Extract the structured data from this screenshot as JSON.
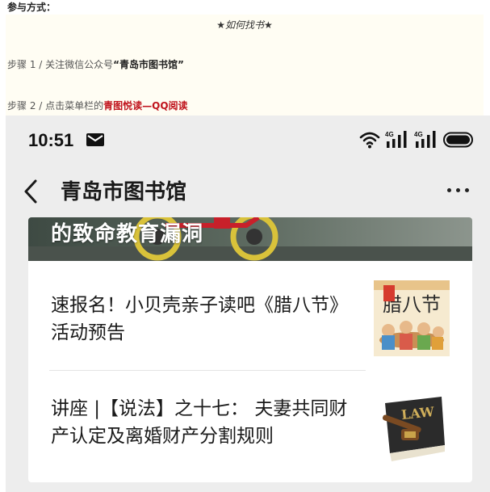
{
  "article": {
    "intro": "参与方式：",
    "how_to": "★如何找书★",
    "step1_prefix": "步骤 1 /   关注微信公众号",
    "step1_highlight": "“青岛市图书馆”",
    "step2_prefix": "步骤 2 /   点击菜单栏的",
    "step2_highlight": "青图悦读—QQ阅读"
  },
  "phone": {
    "status": {
      "time": "10:51",
      "network_label_1": "4G",
      "network_label_2": "4G"
    },
    "nav": {
      "title": "青岛市图书馆"
    },
    "banner_text": "的致命教育漏洞",
    "items": [
      {
        "title": "速报名！小贝壳亲子读吧《腊八节》活动预告",
        "thumb_text": "腊八节"
      },
      {
        "title": "讲座 |【说法】之十七： 夫妻共同财产认定及离婚财产分割规则",
        "thumb_text": "LAW"
      }
    ]
  },
  "colors": {
    "accent_red": "#c0141d",
    "cream_bg": "#fffdf3",
    "phone_bg": "#ededed"
  }
}
